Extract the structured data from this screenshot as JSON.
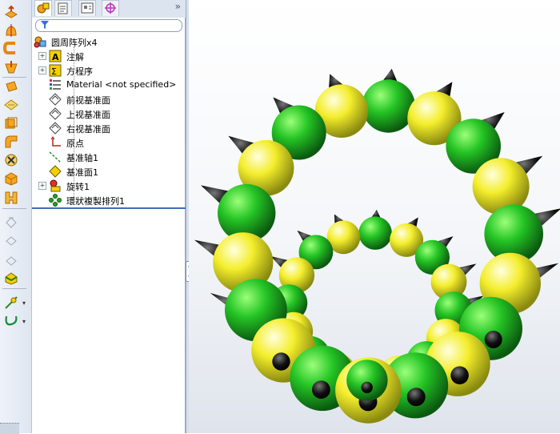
{
  "tree": {
    "root": "圆周阵列x4",
    "items": [
      {
        "label": "注解"
      },
      {
        "label": "方程序"
      },
      {
        "label": "Material <not specified>"
      },
      {
        "label": "前视基准面"
      },
      {
        "label": "上视基准面"
      },
      {
        "label": "右视基准面"
      },
      {
        "label": "原点"
      },
      {
        "label": "基准轴1"
      },
      {
        "label": "基准面1"
      },
      {
        "label": "旋转1"
      },
      {
        "label": "環狀複製排列1"
      }
    ]
  },
  "panel": {
    "expand_glyph": "»"
  },
  "colors": {
    "green": "#1fc21f",
    "yellow": "#f2ee2a",
    "spike": "#111111",
    "accent": "#3e6fb8"
  },
  "icons": {
    "toolbar": [
      "extruded-boss-icon",
      "revolved-boss-icon",
      "swept-boss-icon",
      "lofted-boss-icon",
      "extruded-cut-icon",
      "plane-icon",
      "shell-icon",
      "fillet-icon",
      "hole-wizard-icon",
      "rib-icon",
      "wrap-icon",
      "draft-icon",
      "mirror-icon",
      "pattern-icon",
      "intersect-icon",
      "reference-geometry-icon",
      "curves-icon"
    ],
    "tabs": [
      "feature-manager-icon",
      "property-manager-icon",
      "configuration-manager-icon",
      "dimxpert-icon"
    ]
  }
}
